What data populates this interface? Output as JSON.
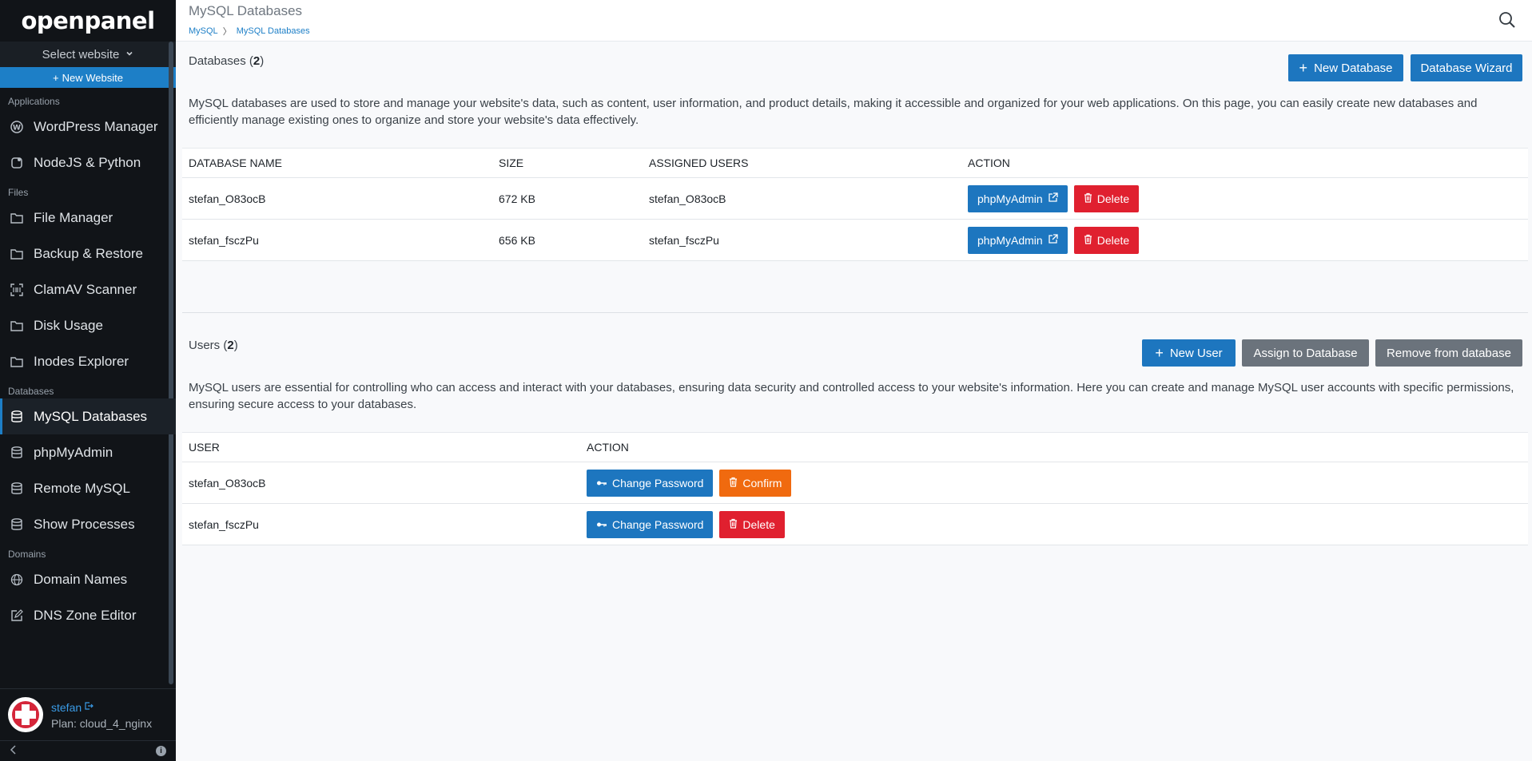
{
  "app": {
    "logo": "openpanel"
  },
  "sidebar": {
    "select_website": "Select website",
    "new_website": "New Website",
    "sections": [
      {
        "label": "Applications",
        "items": [
          {
            "label": "WordPress Manager",
            "icon": "wordpress-icon"
          },
          {
            "label": "NodeJS & Python",
            "icon": "nodejs-icon"
          }
        ]
      },
      {
        "label": "Files",
        "items": [
          {
            "label": "File Manager",
            "icon": "folder-icon"
          },
          {
            "label": "Backup & Restore",
            "icon": "folder-icon"
          },
          {
            "label": "ClamAV Scanner",
            "icon": "scanner-icon"
          },
          {
            "label": "Disk Usage",
            "icon": "folder-icon"
          },
          {
            "label": "Inodes Explorer",
            "icon": "folder-icon"
          }
        ]
      },
      {
        "label": "Databases",
        "items": [
          {
            "label": "MySQL Databases",
            "icon": "database-icon",
            "active": true
          },
          {
            "label": "phpMyAdmin",
            "icon": "database-icon"
          },
          {
            "label": "Remote MySQL",
            "icon": "database-icon"
          },
          {
            "label": "Show Processes",
            "icon": "database-icon"
          }
        ]
      },
      {
        "label": "Domains",
        "items": [
          {
            "label": "Domain Names",
            "icon": "globe-icon"
          },
          {
            "label": "DNS Zone Editor",
            "icon": "edit-icon"
          }
        ]
      }
    ],
    "user": {
      "name": "stefan",
      "plan": "Plan: cloud_4_nginx"
    }
  },
  "header": {
    "title": "MySQL Databases",
    "breadcrumb": [
      "MySQL",
      "MySQL Databases"
    ]
  },
  "databases": {
    "title": "Databases (",
    "count": "2",
    "title_end": ")",
    "new_button": "New Database",
    "wizard_button": "Database Wizard",
    "description": "MySQL databases are used to store and manage your website's data, such as content, user information, and product details, making it accessible and organized for your web applications. On this page, you can easily create new databases and efficiently manage existing ones to organize and store your website's data effectively.",
    "columns": [
      "DATABASE NAME",
      "SIZE",
      "ASSIGNED USERS",
      "ACTION"
    ],
    "rows": [
      {
        "name": "stefan_O83ocB",
        "size": "672 KB",
        "users": "stefan_O83ocB",
        "phpmyadmin": "phpMyAdmin",
        "delete": "Delete"
      },
      {
        "name": "stefan_fsczPu",
        "size": "656 KB",
        "users": "stefan_fsczPu",
        "phpmyadmin": "phpMyAdmin",
        "delete": "Delete"
      }
    ]
  },
  "users": {
    "title": "Users (",
    "count": "2",
    "title_end": ")",
    "new_button": "New  User",
    "assign_button": "Assign  to Database",
    "remove_button": "Remove  from database",
    "description": "MySQL users are essential for controlling who can access and interact with your databases, ensuring data security and controlled access to your website's information. Here you can create and manage MySQL user accounts with specific permissions, ensuring secure access to your databases.",
    "columns": [
      "USER",
      "ACTION"
    ],
    "rows": [
      {
        "name": "stefan_O83ocB",
        "change": "Change Password",
        "action": "Confirm",
        "action_style": "orange"
      },
      {
        "name": "stefan_fsczPu",
        "change": "Change Password",
        "action": "Delete",
        "action_style": "red"
      }
    ]
  },
  "colors": {
    "primary": "#1d76bf",
    "danger": "#e0202f",
    "warning": "#f06a0f",
    "sidebar": "#111418"
  }
}
